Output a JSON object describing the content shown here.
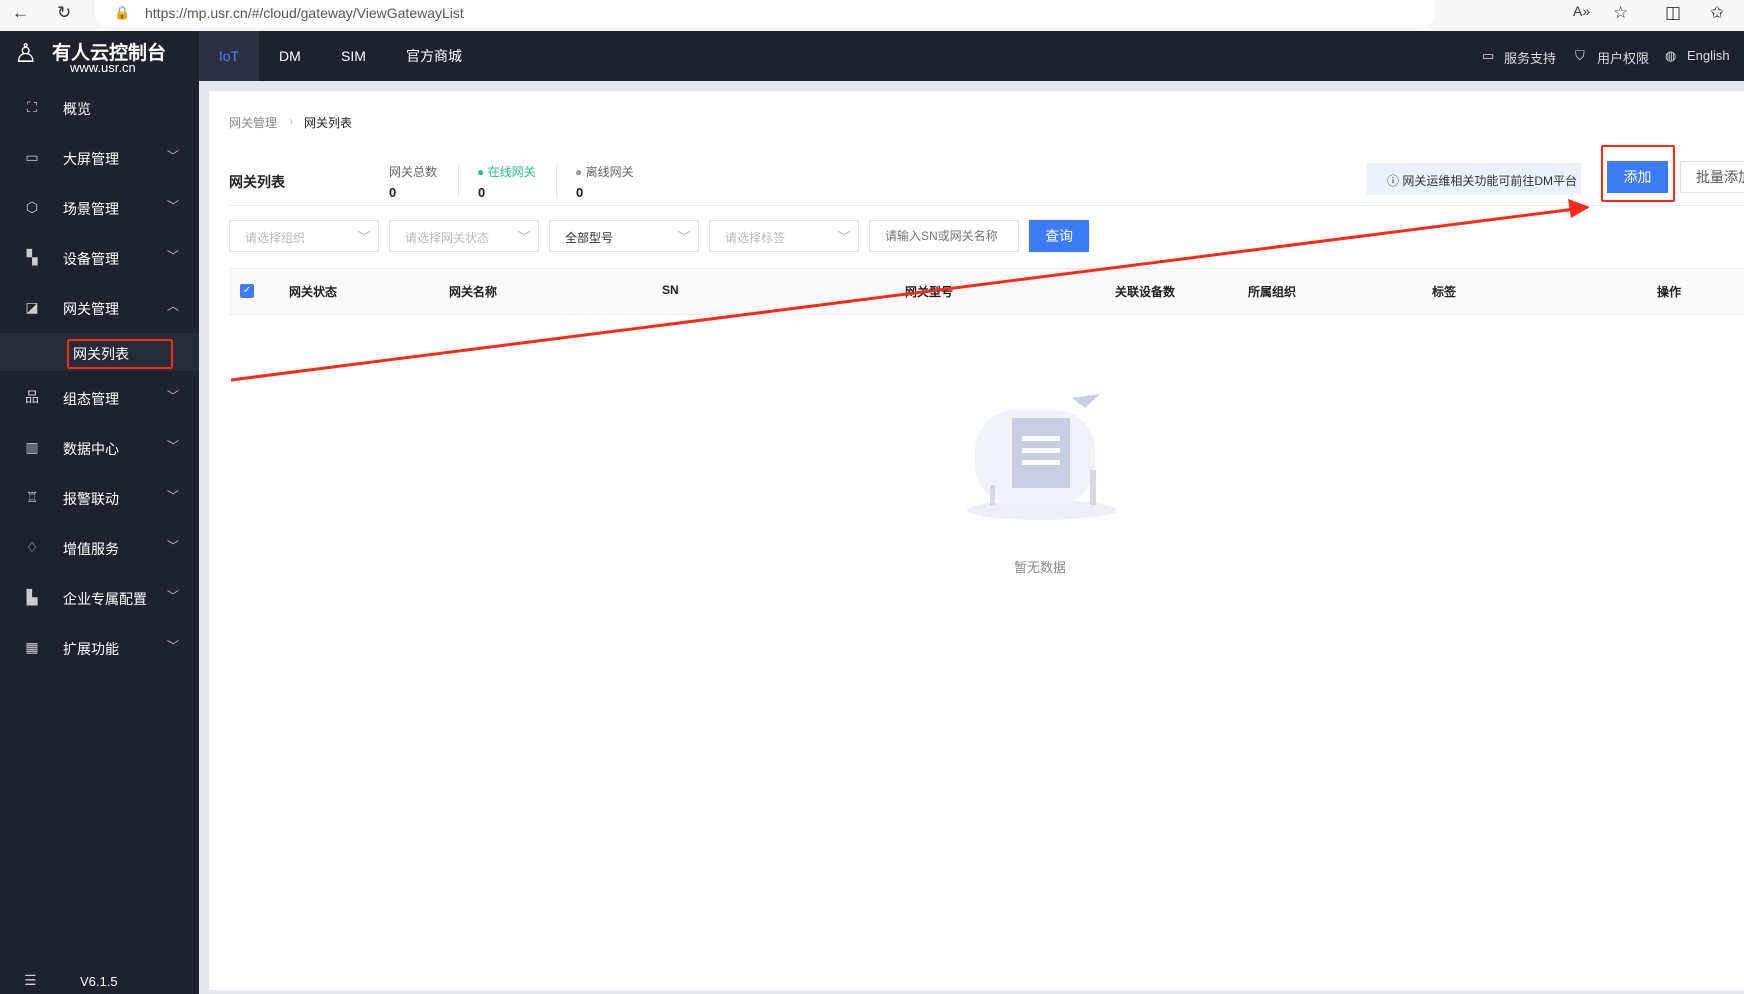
{
  "browser": {
    "url": "https://mp.usr.cn/#/cloud/gateway/ViewGatewayList"
  },
  "topnav": {
    "logo_title": "有人云控制台",
    "logo_sub": "www.usr.cn",
    "tabs": [
      "IoT",
      "DM",
      "SIM",
      "官方商城"
    ],
    "right": [
      "服务支持",
      "用户权限",
      "English"
    ]
  },
  "sidebar": {
    "items": [
      "概览",
      "大屏管理",
      "场景管理",
      "设备管理",
      "网关管理",
      "组态管理",
      "数据中心",
      "报警联动",
      "增值服务",
      "企业专属配置",
      "扩展功能"
    ],
    "sub_item": "网关列表",
    "version": "V6.1.5"
  },
  "breadcrumb": [
    "网关管理",
    "网关列表"
  ],
  "page_title": "网关列表",
  "stats": [
    {
      "label": "网关总数",
      "value": "0"
    },
    {
      "label": "在线网关",
      "value": "0"
    },
    {
      "label": "离线网关",
      "value": "0"
    }
  ],
  "info_text": "网关运维相关功能可前往DM平台",
  "buttons": {
    "add": "添加",
    "batch_add": "批量添加",
    "query": "查询"
  },
  "filters": {
    "org": "请选择组织",
    "status": "请选择网关状态",
    "model": "全部型号",
    "tag": "请选择标签",
    "search_placeholder": "请输入SN或网关名称"
  },
  "table": {
    "columns": [
      "网关状态",
      "网关名称",
      "SN",
      "网关型号",
      "关联设备数",
      "所属组织",
      "标签",
      "操作"
    ]
  },
  "empty_text": "暂无数据",
  "colors": {
    "primary": "#3d7cf7",
    "online": "#2bc18b",
    "annotation": "#ff2a1a"
  }
}
